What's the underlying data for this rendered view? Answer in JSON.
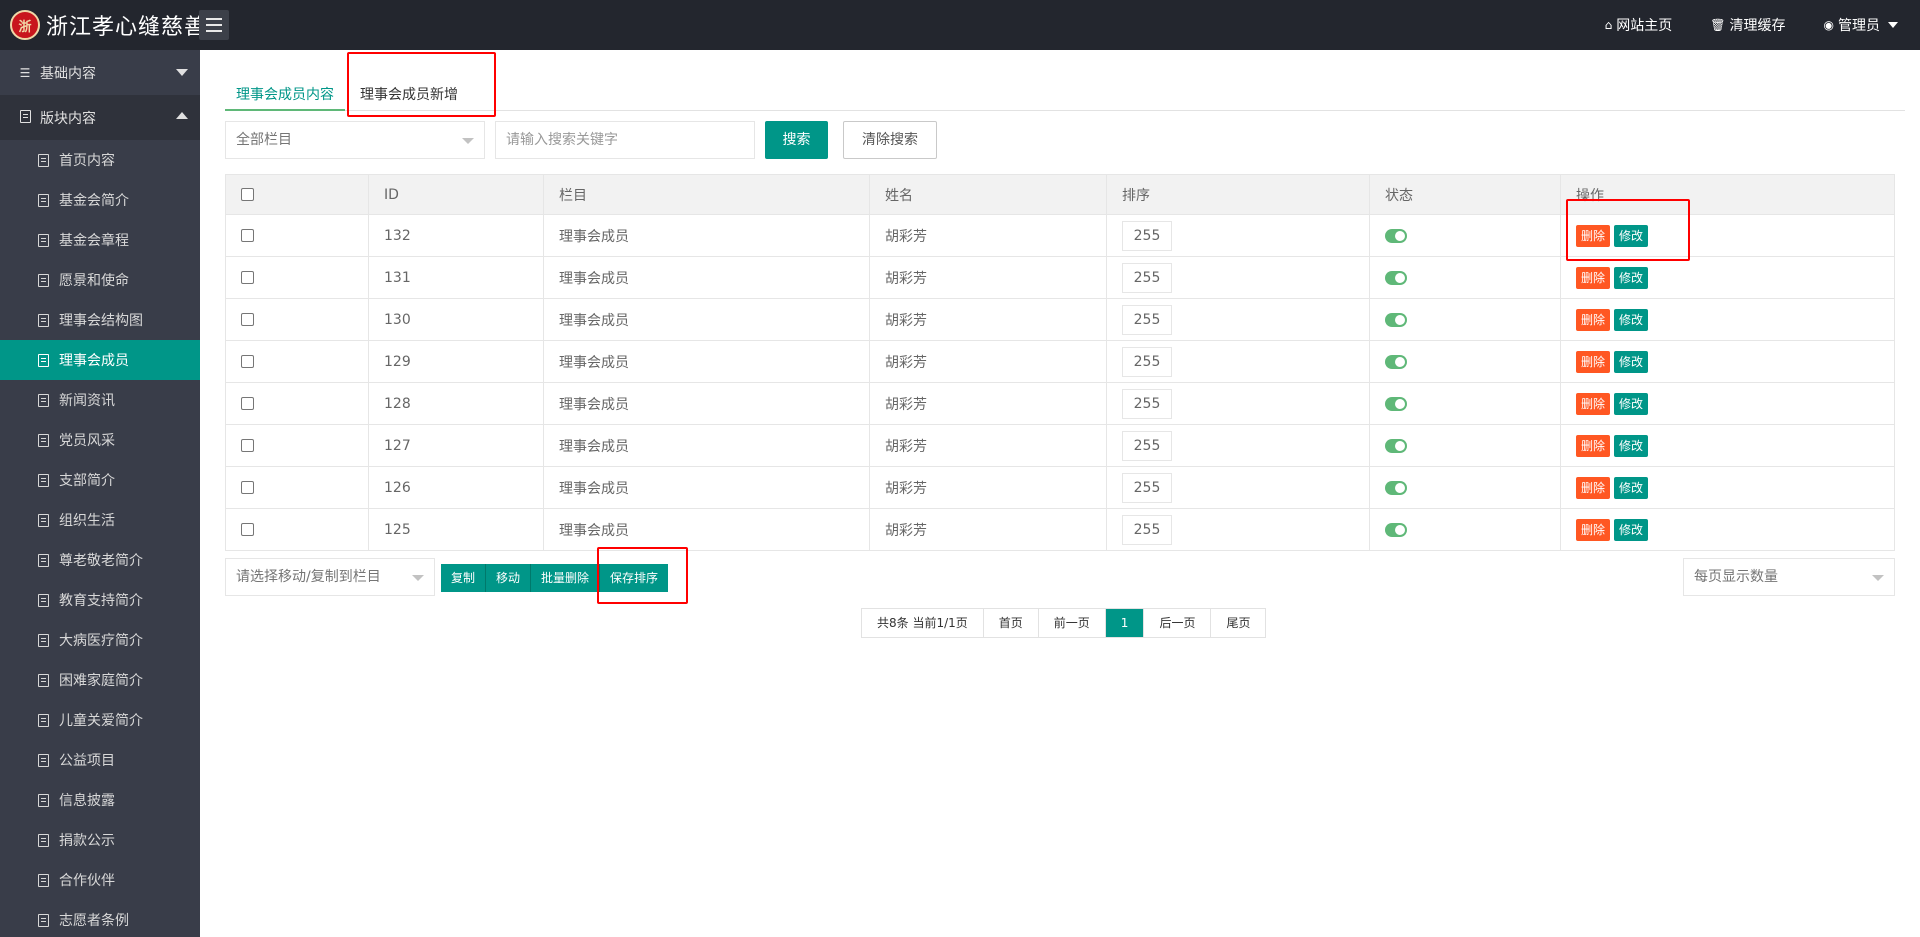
{
  "header": {
    "logo_mark": "浙",
    "site_name": "浙江孝心缝慈善",
    "links": [
      {
        "icon": "home-icon",
        "label": "网站主页"
      },
      {
        "icon": "trash-icon",
        "label": "清理缓存"
      },
      {
        "icon": "user-icon",
        "label": "管理员"
      }
    ]
  },
  "sidebar": {
    "groups": [
      {
        "label": "基础内容",
        "icon": "sliders-icon",
        "expanded": false
      },
      {
        "label": "版块内容",
        "icon": "document-icon",
        "expanded": true
      }
    ],
    "items": [
      "首页内容",
      "基金会简介",
      "基金会章程",
      "愿景和使命",
      "理事会结构图",
      "理事会成员",
      "新闻资讯",
      "党员风采",
      "支部简介",
      "组织生活",
      "尊老敬老简介",
      "教育支持简介",
      "大病医疗简介",
      "困难家庭简介",
      "儿童关爱简介",
      "公益项目",
      "信息披露",
      "捐款公示",
      "合作伙伴",
      "志愿者条例"
    ],
    "active_item": "理事会成员"
  },
  "tabs": {
    "content": "理事会成员内容",
    "add": "理事会成员新增"
  },
  "search": {
    "category_select": "全部栏目",
    "keyword_placeholder": "请输入搜索关键字",
    "search_button": "搜索",
    "clear_button": "清除搜索"
  },
  "table": {
    "headers": [
      "",
      "ID",
      "栏目",
      "姓名",
      "排序",
      "状态",
      "操作"
    ],
    "rows": [
      {
        "id": "132",
        "category": "理事会成员",
        "name": "胡彩芳",
        "sort": "255",
        "enabled": true
      },
      {
        "id": "131",
        "category": "理事会成员",
        "name": "胡彩芳",
        "sort": "255",
        "enabled": true
      },
      {
        "id": "130",
        "category": "理事会成员",
        "name": "胡彩芳",
        "sort": "255",
        "enabled": true
      },
      {
        "id": "129",
        "category": "理事会成员",
        "name": "胡彩芳",
        "sort": "255",
        "enabled": true
      },
      {
        "id": "128",
        "category": "理事会成员",
        "name": "胡彩芳",
        "sort": "255",
        "enabled": true
      },
      {
        "id": "127",
        "category": "理事会成员",
        "name": "胡彩芳",
        "sort": "255",
        "enabled": true
      },
      {
        "id": "126",
        "category": "理事会成员",
        "name": "胡彩芳",
        "sort": "255",
        "enabled": true
      },
      {
        "id": "125",
        "category": "理事会成员",
        "name": "胡彩芳",
        "sort": "255",
        "enabled": true
      }
    ],
    "delete_label": "删除",
    "edit_label": "修改"
  },
  "bulk": {
    "move_select": "请选择移动/复制到栏目",
    "copy": "复制",
    "move": "移动",
    "batch_delete": "批量删除",
    "save_sort": "保存排序",
    "per_page_select": "每页显示数量"
  },
  "pager": {
    "summary": "共8条 当前1/1页",
    "first": "首页",
    "prev": "前一页",
    "current": "1",
    "next": "后一页",
    "last": "尾页"
  },
  "colors": {
    "primary": "#009688",
    "danger": "#ff5722",
    "sidebar_bg": "#393d49",
    "topbar_bg": "#23262e",
    "highlight_box": "#ff0000"
  }
}
